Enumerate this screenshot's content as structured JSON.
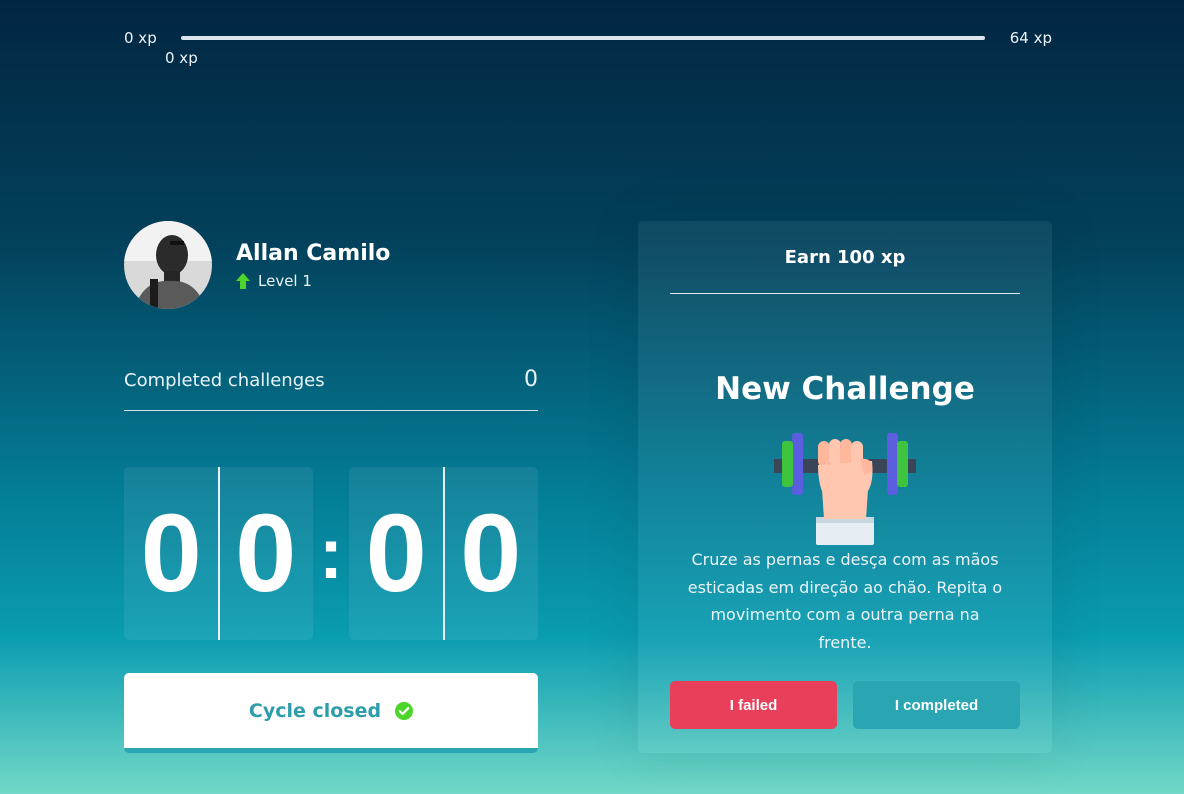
{
  "xp": {
    "min_label": "0 xp",
    "max_label": "64 xp",
    "current_label": "0 xp",
    "progress_fraction": 0
  },
  "profile": {
    "name": "Allan Camilo",
    "level": "Level 1"
  },
  "completed_challenges": {
    "label": "Completed challenges",
    "count": "0"
  },
  "countdown": {
    "minute_left": "0",
    "minute_right": "0",
    "separator": ":",
    "second_left": "0",
    "second_right": "0"
  },
  "cycle_button": {
    "label": "Cycle closed",
    "icon": "check-circle-icon"
  },
  "challenge": {
    "header": "Earn 100 xp",
    "title": "New Challenge",
    "image_icon": "dumbbell-icon",
    "description": "Cruze as pernas e desça com as mãos esticadas em direção ao chão. Repita o movimento com a outra perna na frente.",
    "failed_label": "I failed",
    "completed_label": "I completed"
  },
  "colors": {
    "failed": "#e83f5b",
    "completed": "#2aa6b3",
    "level_up": "#4cd62b",
    "check": "#4cd62b"
  }
}
